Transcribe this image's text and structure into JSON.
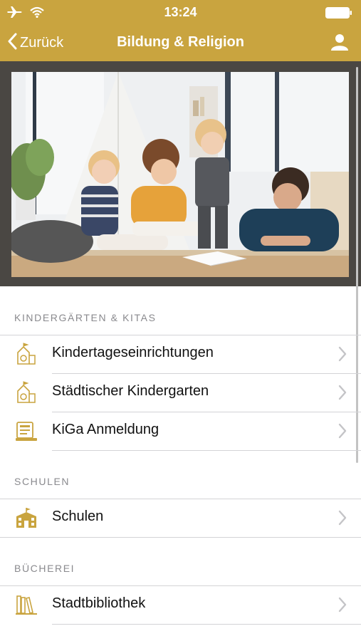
{
  "status_bar": {
    "time": "13:24",
    "icons": [
      "airplane-icon",
      "wifi-icon",
      "battery-icon"
    ]
  },
  "nav": {
    "back_label": "Zurück",
    "title": "Bildung & Religion",
    "profile_icon": "person-icon"
  },
  "hero": {
    "image_subject": "photo"
  },
  "sections": [
    {
      "header": "KINDERGÄRTEN & KITAS",
      "items": [
        {
          "label": "Kindertageseinrichtungen",
          "icon": "kindergarten-icon"
        },
        {
          "label": "Städtischer Kindergarten",
          "icon": "kindergarten-icon"
        },
        {
          "label": "KiGa Anmeldung",
          "icon": "registration-icon"
        }
      ]
    },
    {
      "header": "SCHULEN",
      "items": [
        {
          "label": "Schulen",
          "icon": "school-building-icon"
        }
      ]
    },
    {
      "header": "BÜCHEREI",
      "items": [
        {
          "label": "Stadtbibliothek",
          "icon": "books-icon"
        }
      ]
    }
  ],
  "colors": {
    "accent": "#c9a43f",
    "frame": "#4a4743",
    "section_header": "#8a8a8e",
    "divider": "#d3d3d6",
    "chevron": "#c4c4c7"
  }
}
